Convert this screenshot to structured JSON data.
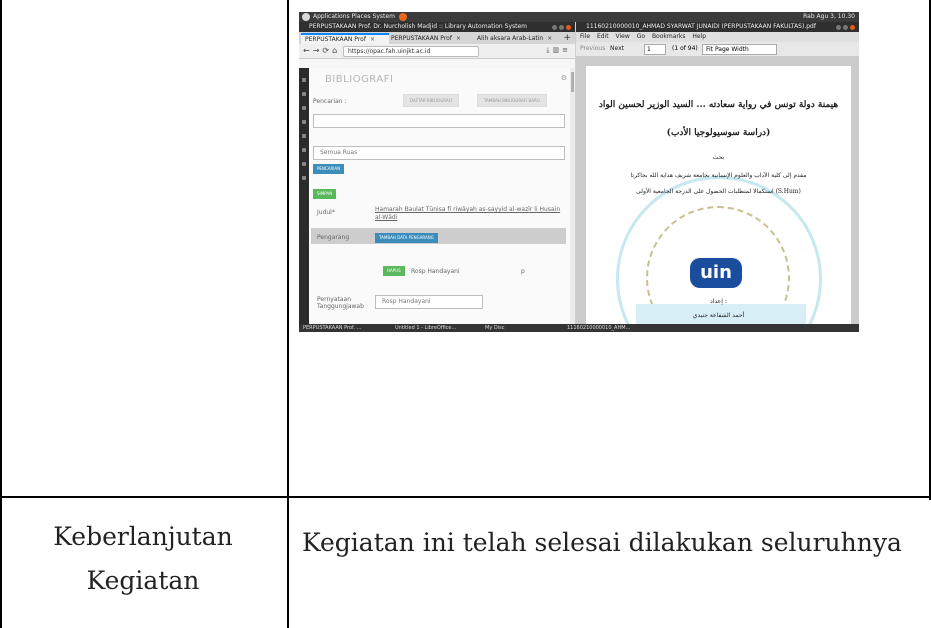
{
  "table": {
    "row2_label_line1": "Keberlanjutan",
    "row2_label_line2": "Kegiatan",
    "row2_value": "Kegiatan ini telah selesai dilakukan seluruhnya"
  },
  "screenshot": {
    "topbar": {
      "menus": "Applications  Places  System",
      "clock": "Rab Agu 3, 10.30"
    },
    "browser": {
      "window_title": "PERPUSTAKAAN Prof. Dr. Nurcholish Madjid :: Library Automation System",
      "tabs": [
        "PERPUSTAKAAN Prof",
        "PERPUSTAKAAN Prof",
        "Alih aksara Arab-Latin"
      ],
      "url": "https://opac.fah.uinjkt.ac.id",
      "heading": "BIBLIOGRAFI",
      "pencarian_label": "Pencarian :",
      "daftar_button": "DAFTAR BIBLIOGRAFI",
      "tambah_button": "TAMBAH BIBLIOGRAFI BARU",
      "select_value": "Semua Ruas",
      "cari_button": "PENCARIAN",
      "simpan_button": "SIMPAN",
      "judul_label": "Judul*",
      "judul_value": "Ḥamarah Baulat Tūnisa fī riwāyah as-sayyid al-wazīr li Ḥusain al-Wādi",
      "pengarang_label": "Pengarang",
      "tambah_pengarang_button": "TAMBAH DATA PENGARANG",
      "hapus_button": "HAPUS",
      "author_name": "Rosp Handayani",
      "author_role": "p",
      "pernyataan_label": "Pernyataan Tanggungjawab",
      "pernyataan_value": "Rosp Handayani"
    },
    "pdf": {
      "window_title": "11160210000010_AHMAD SYARWAT JUNAIDI (PERPUSTAKAAN FAKULTAS).pdf",
      "menu": [
        "File",
        "Edit",
        "View",
        "Go",
        "Bookmarks",
        "Help"
      ],
      "prev": "Previous",
      "next": "Next",
      "page_input": "1",
      "page_of": "(1 of 94)",
      "fit": "Fit Page Width",
      "title_ar": "هيمنة دولة تونس في رواية سعادته ... السيد الوزير لحسين الواد",
      "subtitle_ar": "(دراسة سوسيولوجيا الأدب)",
      "bahth_ar": "بحث",
      "line1_ar": "مقدم إلى كلية الآداب والعلوم الإنسانية بجامعة شريف هداية الله بجاكرتا",
      "line2_ar": "استكمالا لمتطلبات الحصول على الدرجة الجامعية الأولى (S.Hum)",
      "logo": "uin",
      "prepared_ar": "إعداد :",
      "author_ar": "أحمد الشفاعة جنيدي"
    },
    "taskbar": [
      "PERPUSTAKAAN Prof. ...",
      "Untitled 1 - LibreOffice...",
      "My Disc",
      "11160210000010_AHM..."
    ]
  }
}
